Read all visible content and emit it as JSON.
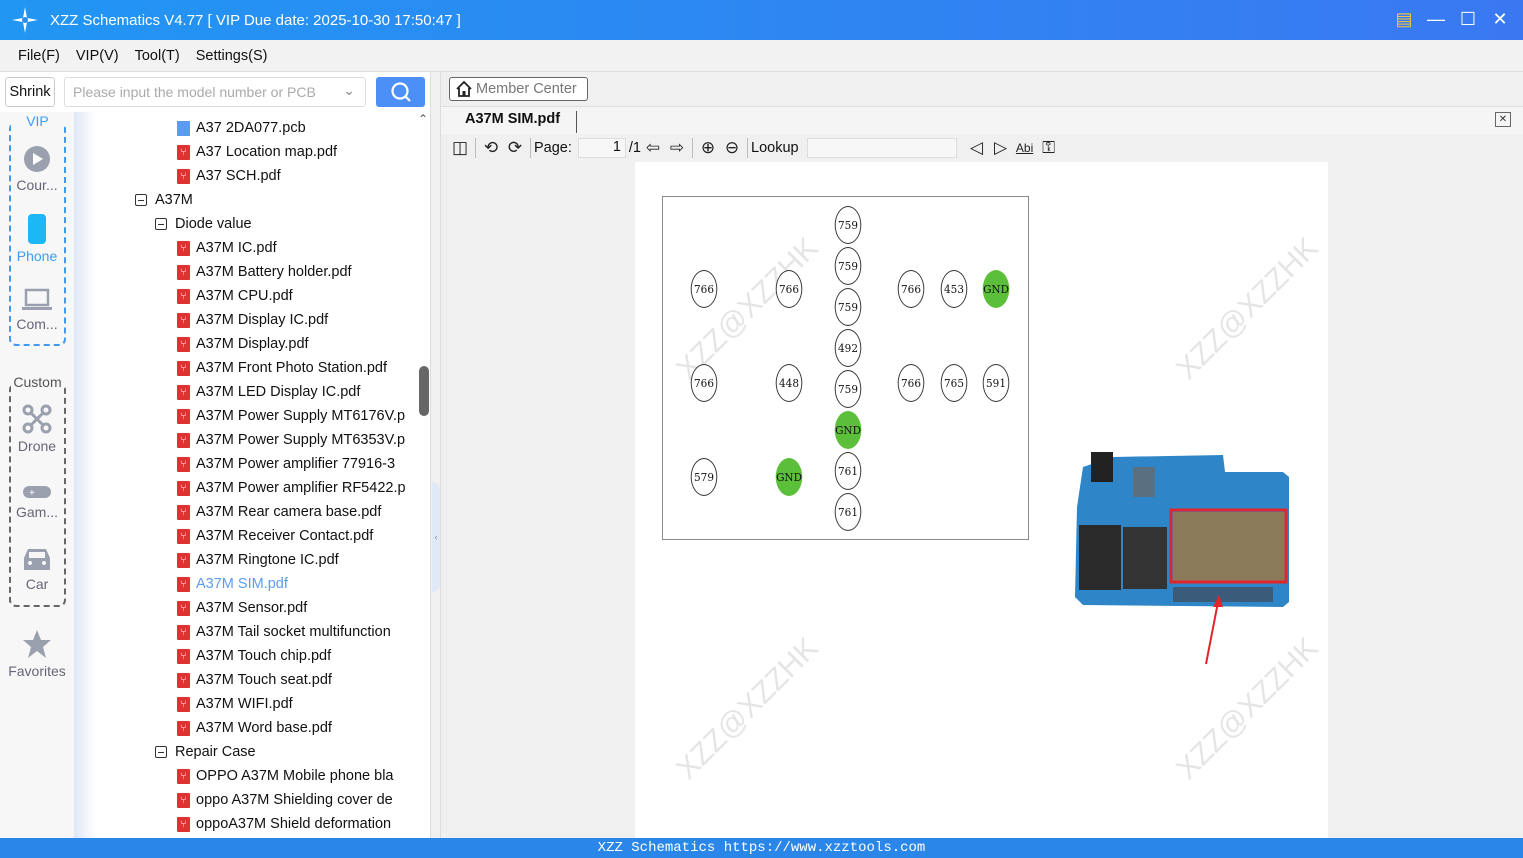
{
  "window": {
    "title": "XZZ Schematics V4.77 [ VIP Due date: 2025-10-30 17:50:47 ]"
  },
  "menu": [
    "File(F)",
    "VIP(V)",
    "Tool(T)",
    "Settings(S)"
  ],
  "search": {
    "shrink_label": "Shrink",
    "placeholder": "Please input the model number or PCB"
  },
  "categories": {
    "vip_label": "VIP",
    "custom_label": "Custom",
    "items": [
      {
        "label": "Cour...",
        "icon": "play-icon"
      },
      {
        "label": "Phone",
        "icon": "phone-icon",
        "active": true
      },
      {
        "label": "Com...",
        "icon": "laptop-icon"
      },
      {
        "label": "Drone",
        "icon": "drone-icon"
      },
      {
        "label": "Gam...",
        "icon": "gamepad-icon"
      },
      {
        "label": "Car",
        "icon": "car-icon"
      },
      {
        "label": "Favorites",
        "icon": "star-icon"
      }
    ],
    "accent": "#3d9bf5"
  },
  "tree": [
    {
      "label": "A37 2DA077.pcb",
      "type": "pcb",
      "level": 2
    },
    {
      "label": "A37 Location map.pdf",
      "type": "pdf",
      "level": 2
    },
    {
      "label": "A37 SCH.pdf",
      "type": "pdf",
      "level": 2
    },
    {
      "label": "A37M",
      "type": "folder",
      "level": 0
    },
    {
      "label": "Diode value",
      "type": "folder",
      "level": 1
    },
    {
      "label": "A37M  IC.pdf",
      "type": "pdf",
      "level": 2
    },
    {
      "label": "A37M Battery holder.pdf",
      "type": "pdf",
      "level": 2
    },
    {
      "label": "A37M CPU.pdf",
      "type": "pdf",
      "level": 2
    },
    {
      "label": "A37M Display IC.pdf",
      "type": "pdf",
      "level": 2
    },
    {
      "label": "A37M Display.pdf",
      "type": "pdf",
      "level": 2
    },
    {
      "label": "A37M Front Photo Station.pdf",
      "type": "pdf",
      "level": 2
    },
    {
      "label": "A37M LED Display IC.pdf",
      "type": "pdf",
      "level": 2
    },
    {
      "label": "A37M Power Supply MT6176V.p",
      "type": "pdf",
      "level": 2
    },
    {
      "label": "A37M Power Supply MT6353V.p",
      "type": "pdf",
      "level": 2
    },
    {
      "label": "A37M Power amplifier 77916-3",
      "type": "pdf",
      "level": 2
    },
    {
      "label": "A37M Power amplifier RF5422.p",
      "type": "pdf",
      "level": 2
    },
    {
      "label": "A37M Rear camera base.pdf",
      "type": "pdf",
      "level": 2
    },
    {
      "label": "A37M Receiver Contact.pdf",
      "type": "pdf",
      "level": 2
    },
    {
      "label": "A37M Ringtone IC.pdf",
      "type": "pdf",
      "level": 2
    },
    {
      "label": "A37M SIM.pdf",
      "type": "pdf",
      "level": 2,
      "selected": true
    },
    {
      "label": "A37M Sensor.pdf",
      "type": "pdf",
      "level": 2
    },
    {
      "label": "A37M Tail socket multifunction",
      "type": "pdf",
      "level": 2
    },
    {
      "label": "A37M Touch chip.pdf",
      "type": "pdf",
      "level": 2
    },
    {
      "label": "A37M Touch seat.pdf",
      "type": "pdf",
      "level": 2
    },
    {
      "label": "A37M WIFI.pdf",
      "type": "pdf",
      "level": 2
    },
    {
      "label": "A37M Word base.pdf",
      "type": "pdf",
      "level": 2
    },
    {
      "label": "Repair Case",
      "type": "folder",
      "level": 1
    },
    {
      "label": "OPPO A37M Mobile phone bla",
      "type": "pdf",
      "level": 2
    },
    {
      "label": "oppo A37M Shielding cover de",
      "type": "pdf",
      "level": 2
    },
    {
      "label": "oppoA37M Shield deformation",
      "type": "pdf",
      "level": 2
    }
  ],
  "viewer": {
    "member_center": "Member Center",
    "tab_title": "A37M SIM.pdf",
    "page_label": "Page:",
    "page_value": "1",
    "page_total": "/1",
    "lookup_label": "Lookup",
    "lookup_value": "",
    "abi_label": "Abi"
  },
  "diagram": {
    "pins": [
      "759",
      "759",
      "759",
      "492",
      "759",
      "GND",
      "761",
      "761",
      "766",
      "766",
      "766",
      "448",
      "579",
      "GND",
      "766",
      "453",
      "GND",
      "766",
      "765",
      "591"
    ],
    "gnd_color": "#5cbf3a",
    "watermark": "XZZ@XZZHK"
  },
  "footer": "XZZ Schematics https://www.xzztools.com"
}
